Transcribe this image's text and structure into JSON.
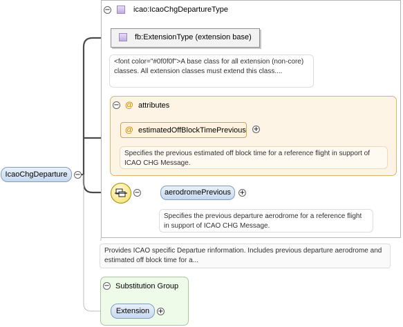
{
  "root": {
    "label": "IcaoChgDeparture"
  },
  "type_box": {
    "label": "icao:IcaoChgDepartureType"
  },
  "extension": {
    "label": "fb:ExtensionType (extension base)",
    "annotation": "<font color=\"#0f0f0f\">A base class for all extension (non-core) classes. All extension classes must extend this class...."
  },
  "attributes": {
    "header": "attributes",
    "item": "estimatedOffBlockTimePrevious",
    "annotation": "Specifies the previous estimated off block time for a reference flight in support of ICAO CHG Message."
  },
  "sequence": {
    "element": "aerodromePrevious",
    "annotation": "Specifies the previous departure aerodrome for a reference flight in support of ICAO CHG Message."
  },
  "root_annotation": "Provides ICAO specific Departue rinformation. Includes previous departure aerodrome and estimated off block time for a...",
  "substitution": {
    "header": "Substitution Group",
    "item": "Extension"
  },
  "symbols": {
    "collapse": "⊖",
    "expand": "⊕",
    "collapse_char": "−",
    "expand_char": "+",
    "at": "@"
  },
  "colors": {
    "attribute_bg": "#fdf4e6",
    "attribute_border": "#e1b26a",
    "substitution_bg": "#eefbe9",
    "substitution_border": "#a8c89a",
    "element_fill": "#c6d8ef",
    "line": "#4a4a4a"
  }
}
